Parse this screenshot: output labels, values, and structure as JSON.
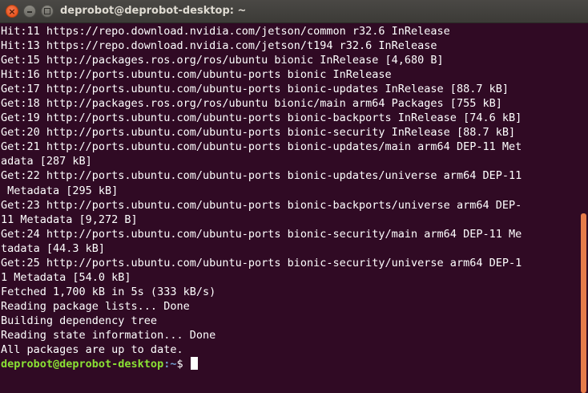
{
  "window": {
    "title": "deprobot@deprobot-desktop: ~"
  },
  "terminal": {
    "lines": [
      "Hit:11 https://repo.download.nvidia.com/jetson/common r32.6 InRelease",
      "Hit:13 https://repo.download.nvidia.com/jetson/t194 r32.6 InRelease",
      "Get:15 http://packages.ros.org/ros/ubuntu bionic InRelease [4,680 B]",
      "Hit:16 http://ports.ubuntu.com/ubuntu-ports bionic InRelease",
      "Get:17 http://ports.ubuntu.com/ubuntu-ports bionic-updates InRelease [88.7 kB]",
      "Get:18 http://packages.ros.org/ros/ubuntu bionic/main arm64 Packages [755 kB]",
      "Get:19 http://ports.ubuntu.com/ubuntu-ports bionic-backports InRelease [74.6 kB]",
      "Get:20 http://ports.ubuntu.com/ubuntu-ports bionic-security InRelease [88.7 kB]",
      "Get:21 http://ports.ubuntu.com/ubuntu-ports bionic-updates/main arm64 DEP-11 Met",
      "adata [287 kB]",
      "Get:22 http://ports.ubuntu.com/ubuntu-ports bionic-updates/universe arm64 DEP-11",
      " Metadata [295 kB]",
      "Get:23 http://ports.ubuntu.com/ubuntu-ports bionic-backports/universe arm64 DEP-",
      "11 Metadata [9,272 B]",
      "Get:24 http://ports.ubuntu.com/ubuntu-ports bionic-security/main arm64 DEP-11 Me",
      "tadata [44.3 kB]",
      "Get:25 http://ports.ubuntu.com/ubuntu-ports bionic-security/universe arm64 DEP-1",
      "1 Metadata [54.0 kB]",
      "Fetched 1,700 kB in 5s (333 kB/s)",
      "Reading package lists... Done",
      "Building dependency tree",
      "Reading state information... Done",
      "All packages are up to date."
    ],
    "prompt": {
      "user_host": "deprobot@deprobot-desktop",
      "path": ":~",
      "symbol": "$ "
    }
  },
  "colors": {
    "background": "#300a24",
    "prompt_user": "#8ae234",
    "prompt_path": "#729fcf",
    "scrollbar_thumb": "#e67b4a"
  },
  "icons": [
    "close-icon",
    "minimize-icon",
    "maximize-icon"
  ]
}
